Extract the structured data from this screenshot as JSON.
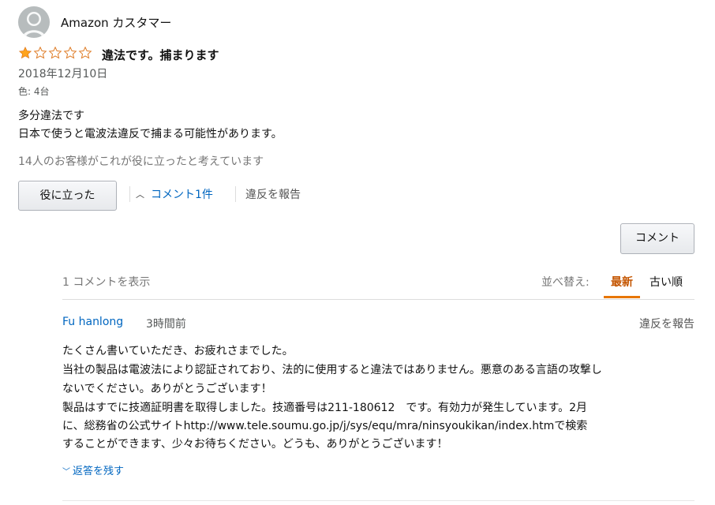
{
  "review": {
    "reviewer_name": "Amazon カスタマー",
    "rating": 1,
    "max_rating": 5,
    "title": "違法です。捕まります",
    "date": "2018年12月10日",
    "variant": "色: 4台",
    "body_lines": [
      "多分違法です",
      "日本で使うと電波法違反で捕まる可能性があります。"
    ],
    "helpful_count_text": "14人のお客様がこれが役に立ったと考えています",
    "helpful_button": "役に立った",
    "comments_toggle": "コメント1件",
    "report_label": "違反を報告"
  },
  "comments_section": {
    "add_comment_button": "コメント",
    "count_text": "1 コメントを表示",
    "sort_label": "並べ替え:",
    "sort_options": [
      "最新",
      "古い順"
    ],
    "selected_sort": "最新",
    "comments": [
      {
        "author": "Fu hanlong",
        "time": "3時間前",
        "report_label": "違反を報告",
        "lines": [
          "たくさん書いていただき、お疲れさまでした。",
          "当社の製品は電波法により認証されており、法的に使用すると違法ではありません。悪意のある言語の攻撃し",
          "ないでください。ありがとうございます！",
          "製品はすでに技適証明書を取得しました。技適番号は211-180612　です。有効力が発生しています。2月",
          "に、総務省の公式サイトhttp://www.tele.soumu.go.jp/j/sys/equ/mra/ninsyoukikan/index.htmで検索",
          "することができます、少々お待ちください。どうも、ありがとうございます！"
        ],
        "reply_label": "返答を残す"
      }
    ]
  },
  "icons": {
    "avatar": "user-avatar-icon",
    "star_filled": "star-filled-icon",
    "star_empty": "star-empty-icon",
    "chevron_up": "chevron-up-icon",
    "chevron_down": "chevron-down-icon"
  },
  "colors": {
    "link": "#0066c0",
    "star": "#ffa41c",
    "active_sort": "#c45500",
    "active_underline": "#e77600",
    "muted": "#767676"
  }
}
